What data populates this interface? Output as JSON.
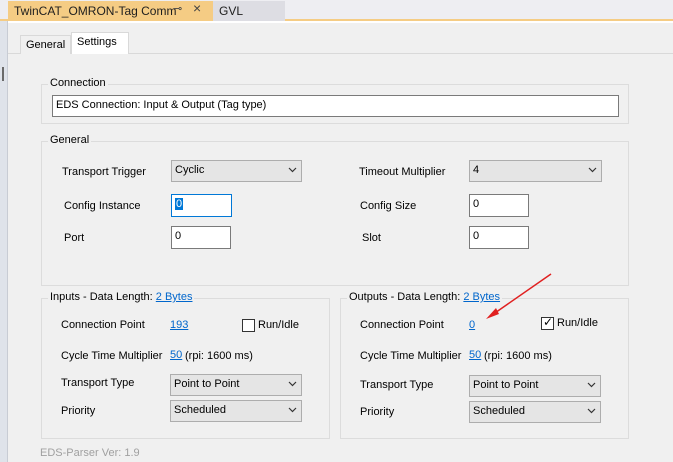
{
  "doc_tabs": {
    "active": {
      "title": "TwinCAT_OMRON-Tag Comm",
      "pin": "⊸",
      "close": "×"
    },
    "inactive": {
      "title": "GVL"
    }
  },
  "prop_tabs": {
    "general": "General",
    "settings": "Settings"
  },
  "connection": {
    "legend": "Connection",
    "value": "EDS Connection: Input & Output (Tag type)"
  },
  "general": {
    "legend": "General",
    "transport_trigger": {
      "label": "Transport Trigger",
      "value": "Cyclic"
    },
    "timeout_multiplier": {
      "label": "Timeout Multiplier",
      "value": "4"
    },
    "config_instance": {
      "label": "Config Instance",
      "value": "0"
    },
    "config_size": {
      "label": "Config Size",
      "value": "0"
    },
    "port": {
      "label": "Port",
      "value": "0"
    },
    "slot": {
      "label": "Slot",
      "value": "0"
    }
  },
  "inputs": {
    "legend_prefix": "Inputs - Data Length: ",
    "legend_link": "2 Bytes",
    "connection_point": {
      "label": "Connection Point",
      "value": "193"
    },
    "run_idle": {
      "label": "Run/Idle",
      "checked": false
    },
    "cycle_time": {
      "label": "Cycle Time Multiplier",
      "value": "50",
      "rpi": "(rpi: 1600 ms)"
    },
    "transport_type": {
      "label": "Transport Type",
      "value": "Point to Point"
    },
    "priority": {
      "label": "Priority",
      "value": "Scheduled"
    }
  },
  "outputs": {
    "legend_prefix": "Outputs - Data Length: ",
    "legend_link": "2 Bytes",
    "connection_point": {
      "label": "Connection Point",
      "value": "0"
    },
    "run_idle": {
      "label": "Run/Idle",
      "checked": true,
      "mark": "✓"
    },
    "cycle_time": {
      "label": "Cycle Time Multiplier",
      "value": "50",
      "rpi": "(rpi: 1600 ms)"
    },
    "transport_type": {
      "label": "Transport Type",
      "value": "Point to Point"
    },
    "priority": {
      "label": "Priority",
      "value": "Scheduled"
    }
  },
  "footer": "EDS-Parser Ver: 1.9",
  "colors": {
    "tab_accent": "#f5cc84",
    "link": "#0066cc",
    "focus": "#0078d7",
    "annotation_arrow": "#e02020"
  }
}
